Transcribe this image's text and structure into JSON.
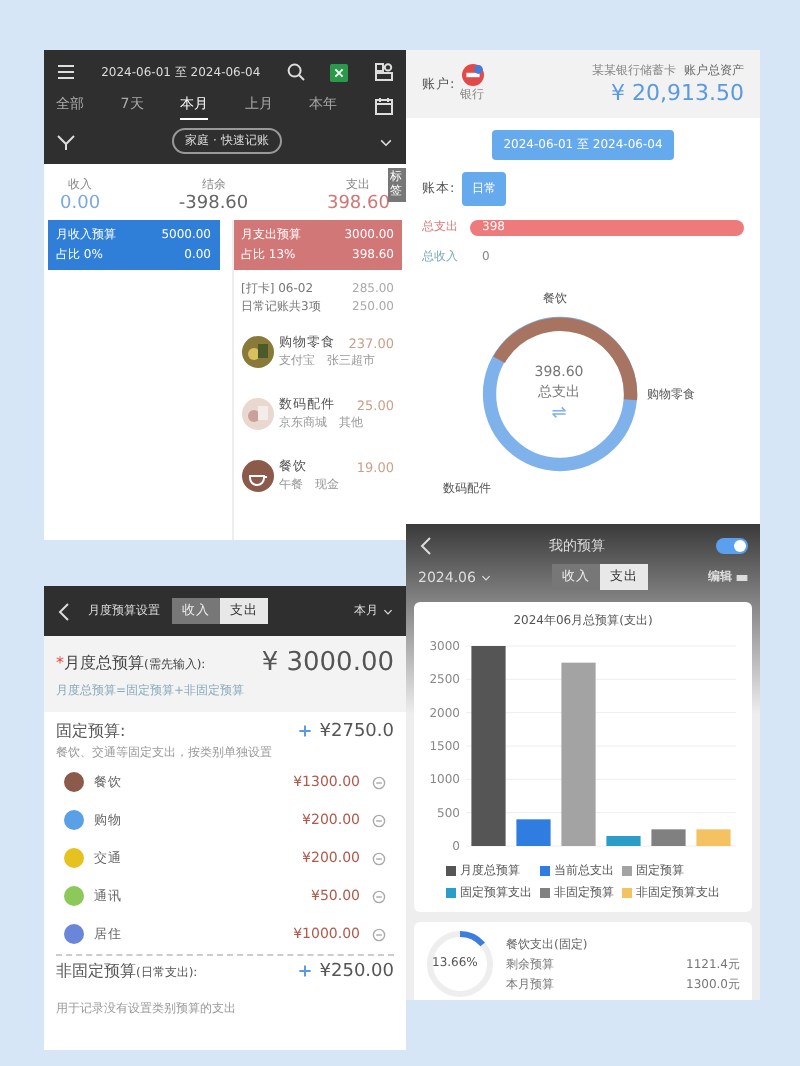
{
  "ledger": {
    "date_range": "2024-06-01 至 2024-06-04",
    "tabs": [
      {
        "label": "全部",
        "selected": false
      },
      {
        "label": "7天",
        "selected": false
      },
      {
        "label": "本月",
        "selected": true
      },
      {
        "label": "上月",
        "selected": false
      },
      {
        "label": "本年",
        "selected": false
      }
    ],
    "filter": "家庭 · 快速记账",
    "side_tab": "标签",
    "summary": [
      {
        "label": "收入",
        "value": "0.00",
        "kind": "income"
      },
      {
        "label": "结余",
        "value": "-398.60",
        "kind": "balance"
      },
      {
        "label": "支出",
        "value": "398.60",
        "kind": "expense"
      }
    ],
    "budget_cards": [
      {
        "title": "月收入预算",
        "amount": "5000.00",
        "share": "占比 0%",
        "value": "0.00",
        "color": "#2f7fd8"
      },
      {
        "title": "月支出预算",
        "amount": "3000.00",
        "share": "占比 13%",
        "value": "398.60",
        "color": "#d27777"
      }
    ],
    "day": {
      "title": "[打卡] 06-02",
      "subtitle": "日常记账共3项",
      "amount": "285.00",
      "total": "250.00"
    },
    "entries": [
      {
        "name": "购物零食",
        "note": "支付宝",
        "place": "张三超市",
        "amount": "237.00"
      },
      {
        "name": "数码配件",
        "note": "京东商城",
        "place": "其他",
        "amount": "25.00"
      },
      {
        "name": "餐饮",
        "note": "午餐",
        "place": "现金",
        "amount": "19.00",
        "kind": "icon"
      }
    ]
  },
  "account": {
    "label": "账户:",
    "bank": "银行",
    "account_name": "某某银行储蓄卡",
    "total_label": "账户总资产",
    "total": "¥ 20,913.50",
    "date_range": "2024-06-01 至 2024-06-04",
    "book_label": "账本:",
    "book": "日常",
    "bars": [
      {
        "label": "总支出",
        "value": "398",
        "filled": true
      },
      {
        "label": "总收入",
        "value": "0",
        "filled": false
      }
    ],
    "donut": {
      "amount": "398.60",
      "label": "总支出",
      "swap": "⇌",
      "labels": [
        "餐饮",
        "购物零食",
        "数码配件"
      ]
    }
  },
  "budget_setup": {
    "title": "月度预算设置",
    "segments": [
      {
        "label": "收入",
        "selected": false
      },
      {
        "label": "支出",
        "selected": true
      }
    ],
    "period": "本月",
    "required_mark": "*",
    "total_label": "月度总预算",
    "total_hint": "(需先输入):",
    "total": "¥ 3000.00",
    "total_note": "月度总预算=固定预算+非固定预算",
    "fixed_label": "固定预算:",
    "fixed": "¥2750.0",
    "fixed_note": "餐饮、交通等固定支出，按类别单独设置",
    "items": [
      {
        "name": "餐饮",
        "amount": "¥1300.00",
        "color": "#8b5a4a"
      },
      {
        "name": "购物",
        "amount": "¥200.00",
        "color": "#5aa0e6"
      },
      {
        "name": "交通",
        "amount": "¥200.00",
        "color": "#e6c21e"
      },
      {
        "name": "通讯",
        "amount": "¥50.00",
        "color": "#8cc85a"
      },
      {
        "name": "居住",
        "amount": "¥1000.00",
        "color": "#6a86d8"
      }
    ],
    "flex_label": "非固定预算",
    "flex_hint": "(日常支出):",
    "flex": "¥250.00",
    "flex_note": "用于记录没有设置类别预算的支出"
  },
  "my_budget": {
    "title": "我的预算",
    "toggle_on": true,
    "month": "2024.06",
    "segments": [
      {
        "label": "收入",
        "selected": false
      },
      {
        "label": "支出",
        "selected": true
      }
    ],
    "edit": "编辑",
    "chart_data": {
      "type": "bar",
      "title": "2024年06月总预算(支出)",
      "series": [
        {
          "name": "月度总预算",
          "color": "#555555",
          "values": [
            3000
          ]
        },
        {
          "name": "当前总支出",
          "color": "#2f7de1",
          "values": [
            400
          ]
        },
        {
          "name": "固定预算",
          "color": "#a3a3a3",
          "values": [
            2750
          ]
        },
        {
          "name": "固定预算支出",
          "color": "#2a9ec9",
          "values": [
            150
          ]
        },
        {
          "name": "非固定预算",
          "color": "#808080",
          "values": [
            250
          ]
        },
        {
          "name": "非固定预算支出",
          "color": "#f5c262",
          "values": [
            250
          ]
        }
      ],
      "grid": true,
      "legend": "bottom",
      "ylim": [
        0,
        3000
      ],
      "yticks": [
        0,
        500,
        1000,
        1500,
        2000,
        2500,
        3000
      ]
    },
    "detail": {
      "percent": "13.66%",
      "level": 0.1366,
      "title": "餐饮支出(固定)",
      "rows": [
        {
          "label": "剩余预算",
          "value": "1121.4元"
        },
        {
          "label": "本月预算",
          "value": "1300.0元"
        }
      ]
    }
  }
}
